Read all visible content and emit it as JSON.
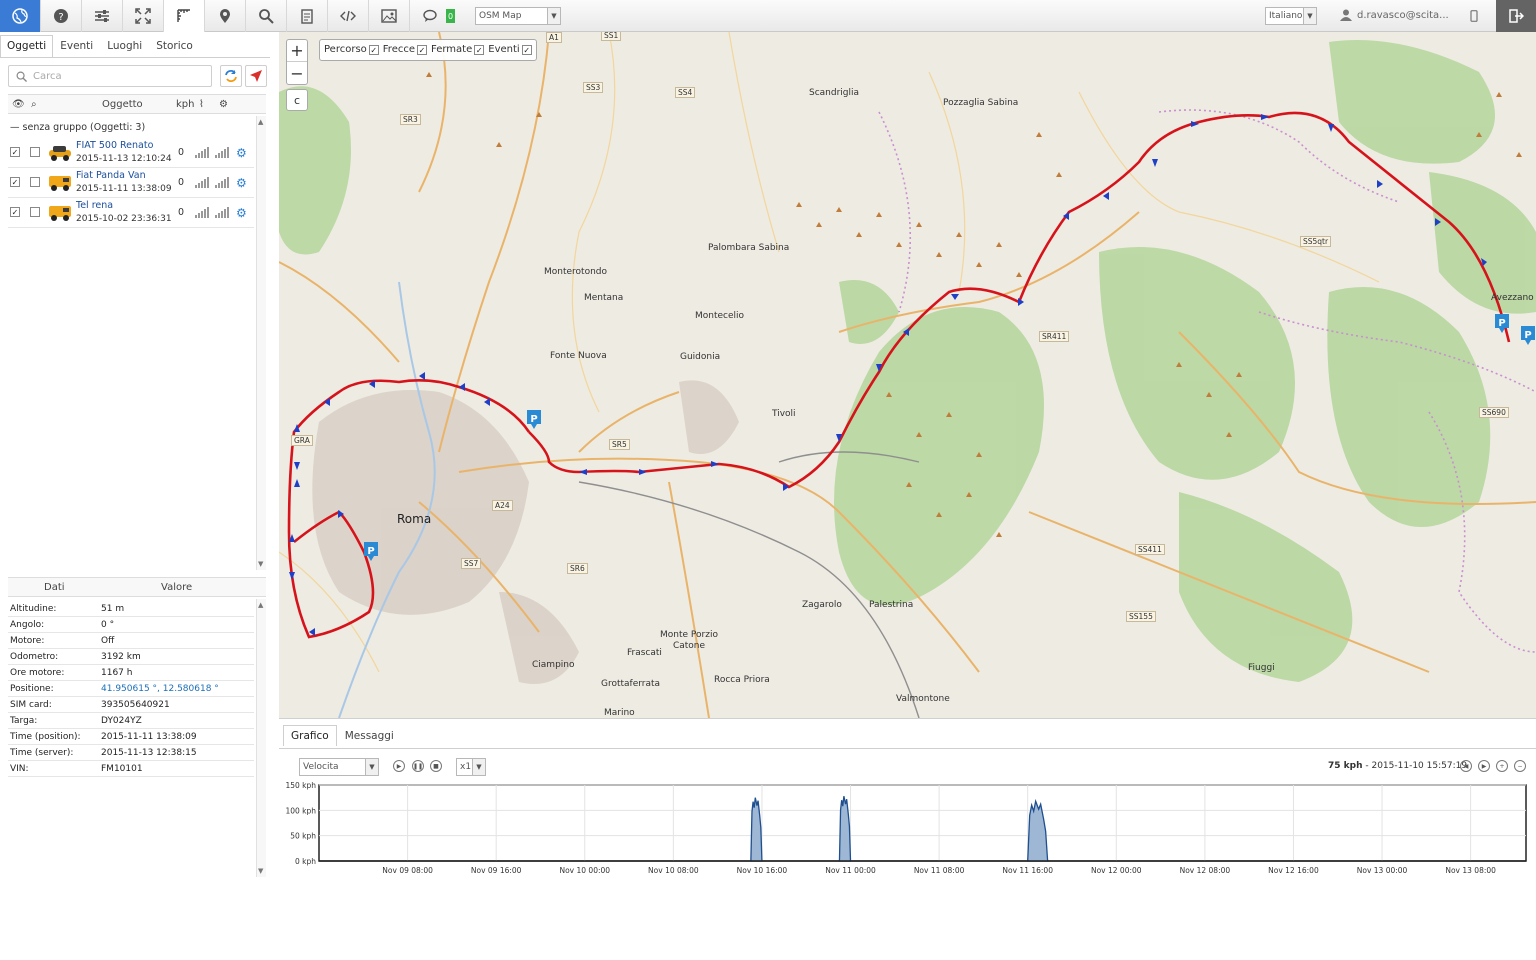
{
  "toolbar": {
    "icons": [
      "globe-icon",
      "help-icon",
      "settings-sliders-icon",
      "fullscreen-icon",
      "ruler-icon",
      "place-icon",
      "search-icon",
      "report-icon",
      "code-icon",
      "image-icon",
      "chat-icon"
    ],
    "chat_count": "0",
    "map_select": "OSM Map",
    "language_select": "Italiano",
    "user": "d.ravasco@scita...",
    "accent": "#3a7bd5"
  },
  "left": {
    "tabs": [
      "Oggetti",
      "Eventi",
      "Luoghi",
      "Storico"
    ],
    "search_placeholder": "Carca",
    "grid_headers": {
      "object": "Oggetto",
      "speed": "kph"
    },
    "group_label": "senza gruppo (Oggetti: 3)",
    "objects": [
      {
        "name": "FIAT 500 Renato",
        "time": "2015-11-13 12:10:24",
        "speed": "0"
      },
      {
        "name": "Fiat Panda Van",
        "time": "2015-11-11 13:38:09",
        "speed": "0"
      },
      {
        "name": "Tel rena",
        "time": "2015-10-02 23:36:31",
        "speed": "0"
      }
    ],
    "props_headers": {
      "data": "Dati",
      "value": "Valore"
    },
    "props": [
      {
        "k": "Altitudine:",
        "v": "51 m"
      },
      {
        "k": "Angolo:",
        "v": "0 °"
      },
      {
        "k": "Motore:",
        "v": "Off"
      },
      {
        "k": "Odometro:",
        "v": "3192 km"
      },
      {
        "k": "Ore motore:",
        "v": "1167 h"
      },
      {
        "k": "Positione:",
        "v": "41.950615 °, 12.580618 °"
      },
      {
        "k": "SIM card:",
        "v": "393505640921"
      },
      {
        "k": "Targa:",
        "v": "DY024YZ"
      },
      {
        "k": "Time (position):",
        "v": "2015-11-11 13:38:09"
      },
      {
        "k": "Time (server):",
        "v": "2015-11-13 12:38:15"
      },
      {
        "k": "VIN:",
        "v": "FM10101"
      }
    ]
  },
  "map": {
    "zoom_in": "+",
    "zoom_out": "−",
    "c_button": "c",
    "layers": [
      "Percorso",
      "Frecce",
      "Fermate",
      "Eventi"
    ],
    "places": [
      {
        "t": "Scandriglia"
      },
      {
        "t": "Pozzaglia Sabina"
      },
      {
        "t": "Palombara Sabina"
      },
      {
        "t": "Monterotondo"
      },
      {
        "t": "Mentana"
      },
      {
        "t": "Montecelio"
      },
      {
        "t": "Fonte Nuova"
      },
      {
        "t": "Guidonia"
      },
      {
        "t": "Tivoli"
      },
      {
        "t": "Roma"
      },
      {
        "t": "Zagarolo"
      },
      {
        "t": "Palestrina"
      },
      {
        "t": "Monte Porzio Catone"
      },
      {
        "t": "Frascati"
      },
      {
        "t": "Ciampino"
      },
      {
        "t": "Grottaferrata"
      },
      {
        "t": "Rocca Priora"
      },
      {
        "t": "Marino"
      },
      {
        "t": "Valmontone"
      },
      {
        "t": "Fiuggi"
      },
      {
        "t": "Avezzano"
      }
    ],
    "roads": [
      {
        "t": "A1"
      },
      {
        "t": "SS1"
      },
      {
        "t": "SS4"
      },
      {
        "t": "SS3"
      },
      {
        "t": "SR3"
      },
      {
        "t": "A24"
      },
      {
        "t": "GRA"
      },
      {
        "t": "SR5"
      },
      {
        "t": "SS411"
      },
      {
        "t": "SR411"
      },
      {
        "t": "SS5qtr"
      },
      {
        "t": "SS690"
      },
      {
        "t": "SS155"
      },
      {
        "t": "SS7"
      },
      {
        "t": "SR6"
      }
    ]
  },
  "bottom": {
    "tabs": [
      "Grafico",
      "Messaggi"
    ],
    "metric_select": "Velocita",
    "speed_select": "x1",
    "info_value": "75 kph",
    "info_time": " - 2015-11-10 15:57:19"
  },
  "chart_data": {
    "type": "area",
    "title": "",
    "ylabel": "",
    "ylim": [
      0,
      150
    ],
    "y_ticks": [
      "150 kph",
      "100 kph",
      "50 kph",
      "0 kph"
    ],
    "x_ticks": [
      "Nov 09 08:00",
      "Nov 09 16:00",
      "Nov 10 00:00",
      "Nov 10 08:00",
      "Nov 10 16:00",
      "Nov 11 00:00",
      "Nov 11 08:00",
      "Nov 11 16:00",
      "Nov 12 00:00",
      "Nov 12 08:00",
      "Nov 12 16:00",
      "Nov 13 00:00",
      "Nov 13 08:00"
    ],
    "series": [
      {
        "bursts": [
          {
            "start_hours": 39.0,
            "end_hours": 40.0,
            "peak": 125
          },
          {
            "start_hours": 47.0,
            "end_hours": 48.0,
            "peak": 128
          },
          {
            "start_hours": 64.0,
            "end_hours": 65.8,
            "peak": 118
          }
        ]
      }
    ],
    "x_range_hours": [
      0,
      109
    ],
    "x_origin": "Nov 09 00:00",
    "color": "#1f4f8f"
  }
}
